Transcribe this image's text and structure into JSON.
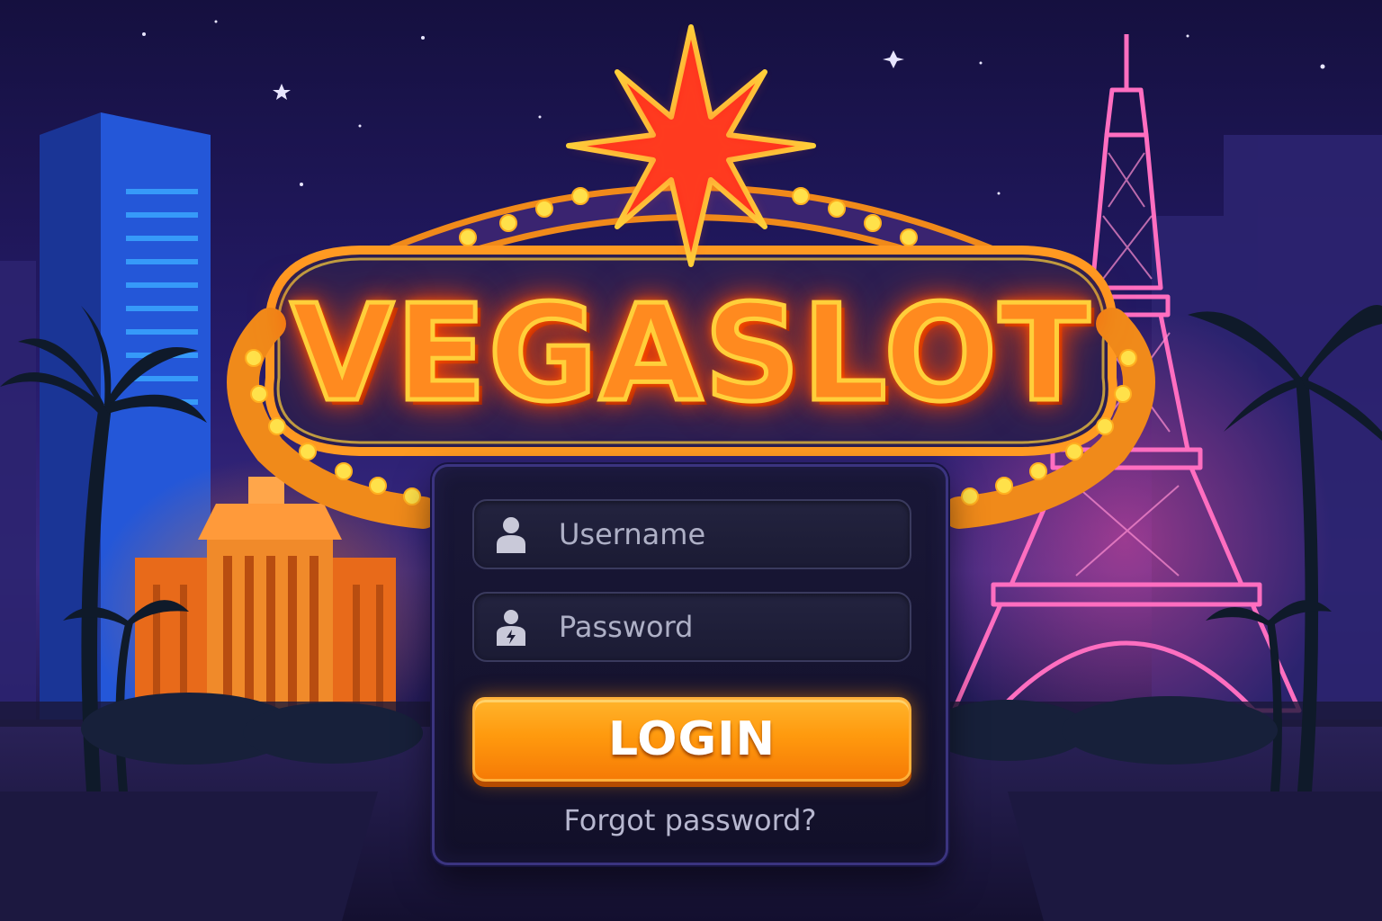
{
  "brand": {
    "title": "VEGASLOT"
  },
  "login_form": {
    "username": {
      "placeholder": "Username",
      "value": "",
      "icon": "user-icon"
    },
    "password": {
      "placeholder": "Password",
      "value": "",
      "icon": "lock-person-icon"
    },
    "login_label": "LOGIN",
    "forgot_password_label": "Forgot password?"
  },
  "colors": {
    "background_top": "#15103f",
    "sign_text": "#ff8a1f",
    "sign_bulbs": "#ffd23a",
    "star": "#ff2a1a",
    "button": "#ff9a0e",
    "panel": "#191737"
  }
}
